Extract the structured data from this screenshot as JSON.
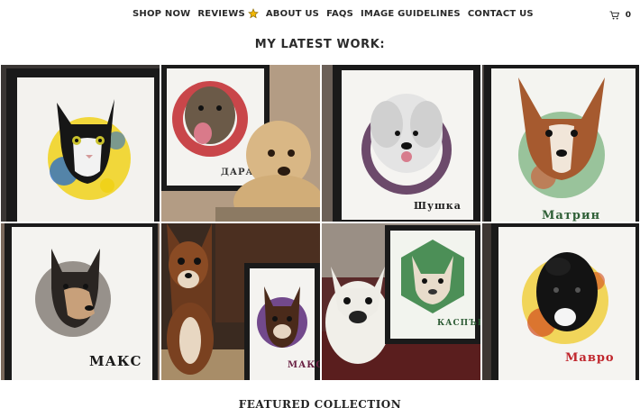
{
  "nav": {
    "items": [
      {
        "label": "SHOP NOW"
      },
      {
        "label": "REVIEWS"
      },
      {
        "label": "ABOUT US"
      },
      {
        "label": "FAQS"
      },
      {
        "label": "IMAGE GUIDELINES"
      },
      {
        "label": "CONTACT US"
      }
    ],
    "cart_count": "0",
    "icons": {
      "reviews": "star-icon",
      "cart": "cart-icon"
    },
    "star_color": "#f2b705"
  },
  "section_title": "MY LATEST WORK:",
  "gallery": {
    "tiles": [
      {
        "name": "",
        "subject": "cat portrait"
      },
      {
        "name": "ДАРА",
        "subject": "dog portrait with labrador"
      },
      {
        "name": "Шушка",
        "subject": "fluffy white dog portrait"
      },
      {
        "name": "Матрин",
        "subject": "corgi portrait"
      },
      {
        "name": "МАКС",
        "subject": "small dog portrait"
      },
      {
        "name": "МАКС",
        "subject": "chihuahua with portrait"
      },
      {
        "name": "КАСПЪР",
        "subject": "french bulldog with portrait"
      },
      {
        "name": "Мавро",
        "subject": "black dog portrait"
      }
    ]
  },
  "next_section_title": "FEATURED COLLECTION"
}
